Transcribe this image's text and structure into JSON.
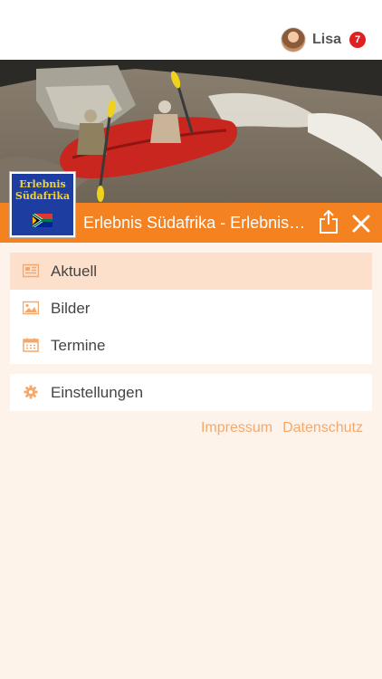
{
  "user": {
    "name": "Lisa",
    "notification_count": "7"
  },
  "group": {
    "title": "Erlebnis Südafrika - Erlebnis Südafrika",
    "logo_line1": "Erlebnis",
    "logo_line2": "Südafrika"
  },
  "menu": {
    "items": [
      {
        "label": "Aktuell",
        "icon": "newspaper-icon",
        "active": true
      },
      {
        "label": "Bilder",
        "icon": "image-icon",
        "active": false
      },
      {
        "label": "Termine",
        "icon": "calendar-icon",
        "active": false
      }
    ],
    "settings_label": "Einstellungen"
  },
  "footer": {
    "impressum": "Impressum",
    "datenschutz": "Datenschutz"
  },
  "colors": {
    "accent": "#f58220",
    "background": "#fdf3ea",
    "badge": "#e02020",
    "link": "#f3a96e"
  }
}
